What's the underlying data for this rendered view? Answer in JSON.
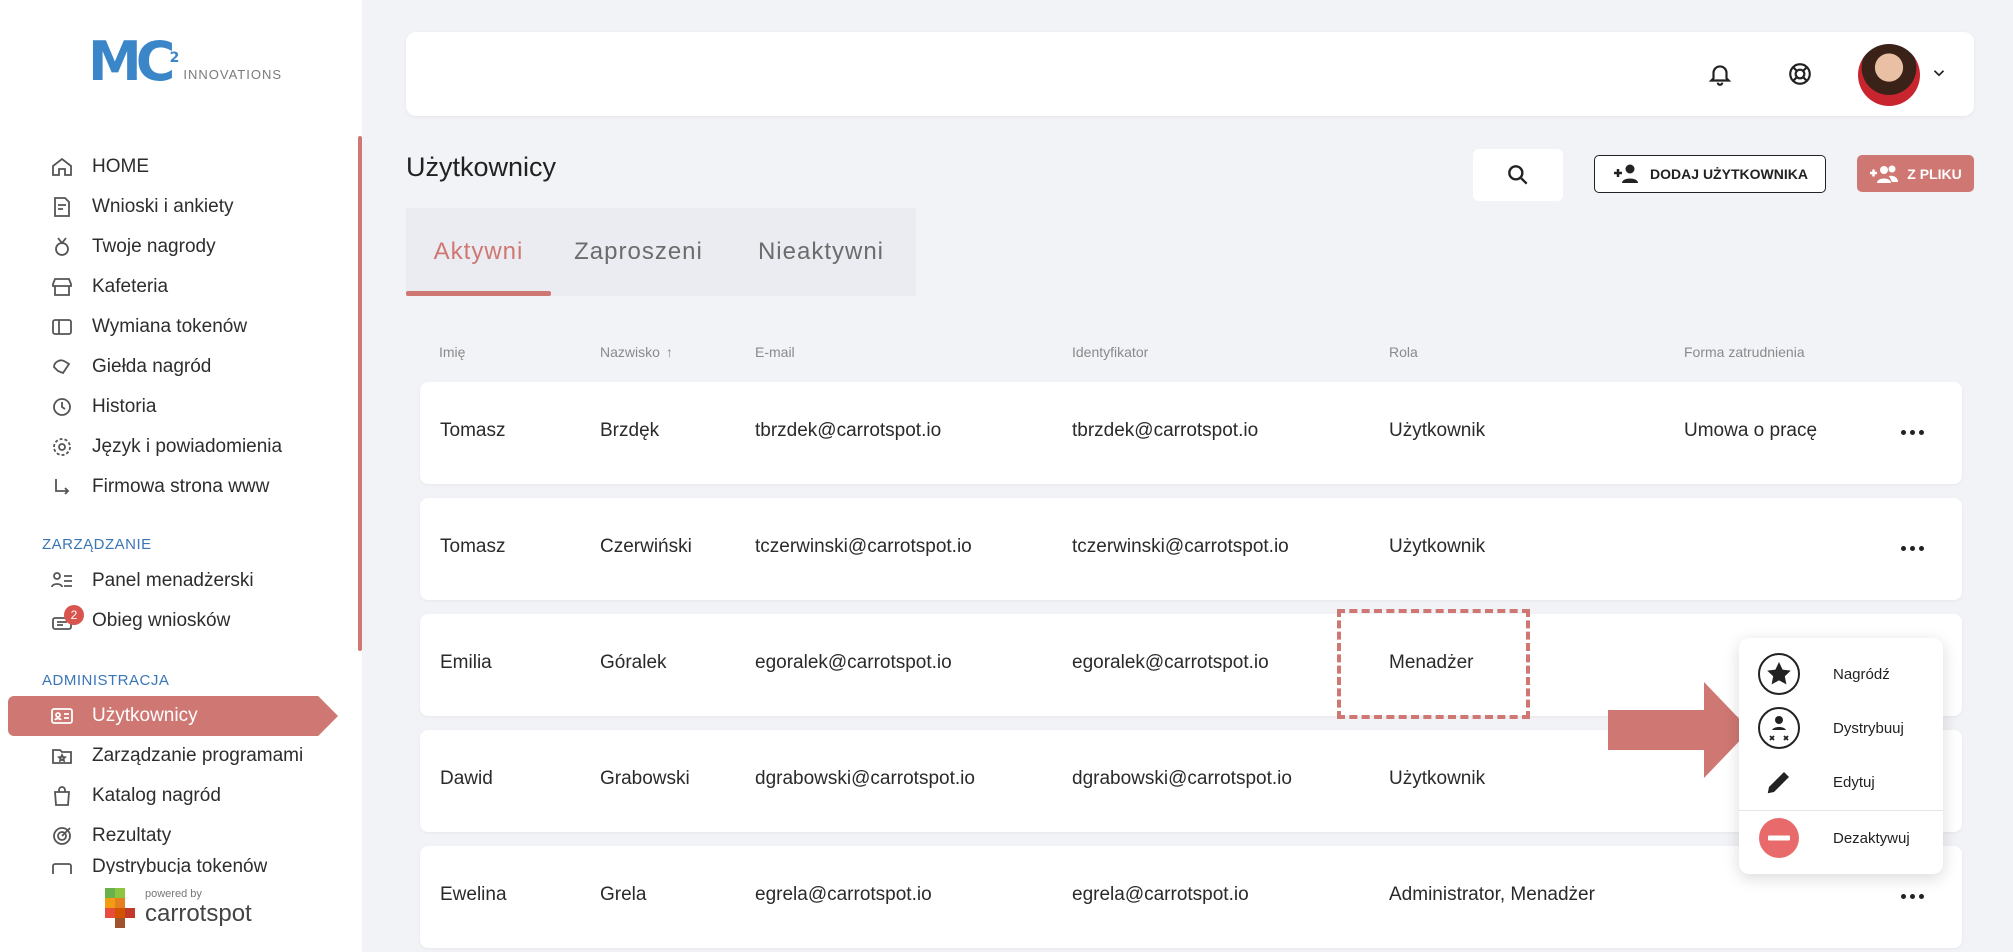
{
  "brand": {
    "logo_mark": "MC",
    "logo_sup": "2",
    "logo_text": "INNOVATIONS",
    "powered_by": "powered by",
    "powered_name": "carrotspot"
  },
  "colors": {
    "accent": "#cf7772",
    "background": "#f2f3f7",
    "section_label": "#3a76b5",
    "logo": "#3a86c8"
  },
  "sidebar": {
    "items": [
      {
        "label": "HOME",
        "icon": "home-icon"
      },
      {
        "label": "Wnioski i ankiety",
        "icon": "form-icon"
      },
      {
        "label": "Twoje nagrody",
        "icon": "medal-icon"
      },
      {
        "label": "Kafeteria",
        "icon": "store-icon"
      },
      {
        "label": "Wymiana tokenów",
        "icon": "ticket-icon"
      },
      {
        "label": "Giełda nagród",
        "icon": "exchange-icon"
      },
      {
        "label": "Historia",
        "icon": "history-icon"
      },
      {
        "label": "Język i powiadomienia",
        "icon": "gear-icon"
      },
      {
        "label": "Firmowa strona www",
        "icon": "arrow-return-icon"
      }
    ],
    "section_management": "ZARZĄDZANIE",
    "management_items": [
      {
        "label": "Panel menadżerski",
        "icon": "manager-panel-icon"
      },
      {
        "label": "Obieg wniosków",
        "icon": "workflow-icon",
        "badge": "2"
      }
    ],
    "section_admin": "ADMINISTRACJA",
    "admin_items": [
      {
        "label": "Użytkownicy",
        "icon": "id-card-icon",
        "active": true
      },
      {
        "label": "Zarządzanie programami",
        "icon": "program-icon"
      },
      {
        "label": "Katalog nagród",
        "icon": "bag-icon"
      },
      {
        "label": "Rezultaty",
        "icon": "target-icon"
      },
      {
        "label": "Dystrybucja tokenów",
        "icon": "token-icon"
      }
    ]
  },
  "topbar": {
    "bell_icon": "bell-icon",
    "help_icon": "lifebuoy-icon",
    "avatar_icon": "user-avatar",
    "menu_icon": "chevron-down-icon"
  },
  "header": {
    "title": "Użytkownicy",
    "add_user_label": "DODAJ UŻYTKOWNIKA",
    "from_file_label": "Z PLIKU"
  },
  "tabs": [
    {
      "label": "Aktywni",
      "active": true
    },
    {
      "label": "Zaproszeni",
      "active": false
    },
    {
      "label": "Nieaktywni",
      "active": false
    }
  ],
  "table": {
    "columns": [
      "Imię",
      "Nazwisko",
      "E-mail",
      "Identyfikator",
      "Rola",
      "Forma zatrudnienia"
    ],
    "sort_column_index": 1,
    "rows": [
      [
        "Tomasz",
        "Brzdęk",
        "tbrzdek@carrotspot.io",
        "tbrzdek@carrotspot.io",
        "Użytkownik",
        "Umowa o pracę"
      ],
      [
        "Tomasz",
        "Czerwiński",
        "tczerwinski@carrotspot.io",
        "tczerwinski@carrotspot.io",
        "Użytkownik",
        ""
      ],
      [
        "Emilia",
        "Góralek",
        "egoralek@carrotspot.io",
        "egoralek@carrotspot.io",
        "Menadżer",
        ""
      ],
      [
        "Dawid",
        "Grabowski",
        "dgrabowski@carrotspot.io",
        "dgrabowski@carrotspot.io",
        "Użytkownik",
        ""
      ],
      [
        "Ewelina",
        "Grela",
        "egrela@carrotspot.io",
        "egrela@carrotspot.io",
        "Administrator, Menadżer",
        ""
      ]
    ]
  },
  "row_menu": {
    "items": [
      {
        "label": "Nagródź",
        "icon": "star-icon"
      },
      {
        "label": "Dystrybuuj",
        "icon": "distribute-icon"
      },
      {
        "label": "Edytuj",
        "icon": "pencil-icon"
      },
      {
        "label": "Dezaktywuj",
        "icon": "minus-circle-icon"
      }
    ]
  }
}
